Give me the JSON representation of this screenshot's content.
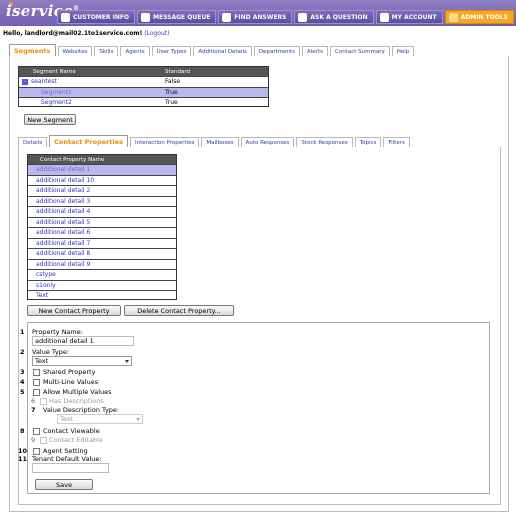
{
  "brand": {
    "logo_text": "service",
    "trademark": "®"
  },
  "topnav": [
    {
      "label": "CUSTOMER INFO",
      "icon": "customer-icon",
      "active": false
    },
    {
      "label": "MESSAGE QUEUE",
      "icon": "envelope-icon",
      "active": false
    },
    {
      "label": "FIND ANSWERS",
      "icon": "book-icon",
      "active": false
    },
    {
      "label": "ASK A QUESTION",
      "icon": "question-icon",
      "active": false
    },
    {
      "label": "MY ACCOUNT",
      "icon": "account-icon",
      "active": false
    },
    {
      "label": "ADMIN TOOLS",
      "icon": "tools-icon",
      "active": true
    }
  ],
  "greeting": {
    "hello": "Hello, landlord@mail02.1to1service.com!",
    "logout": "(Logout)"
  },
  "main_tabs": [
    "Segments",
    "Websites",
    "Skills",
    "Agents",
    "User Types",
    "Additional Details",
    "Departments",
    "Alerts",
    "Contact Summary",
    "Help"
  ],
  "segments": {
    "columns": [
      "Segment Name",
      "Standard"
    ],
    "rows": [
      {
        "name": "seantest",
        "standard": "False",
        "selected": false,
        "expander": "-"
      },
      {
        "name": "Segment1",
        "standard": "True",
        "selected": true
      },
      {
        "name": "Segment2",
        "standard": "True",
        "selected": false
      }
    ],
    "new_button": "New Segment"
  },
  "sub_tabs": [
    "Details",
    "Contact Properties",
    "Interaction Properties",
    "Mailboxes",
    "Auto Responses",
    "Stock Responses",
    "Topics",
    "Filters"
  ],
  "contact_properties": {
    "column": "Contact Property Name",
    "rows": [
      "additional detail 1",
      "additional detail 10",
      "additional detail 2",
      "additional detail 3",
      "additional detail 4",
      "additional detail 5",
      "additional detail 6",
      "additional detail 7",
      "additional detail 8",
      "additional detail 9",
      "cstype",
      "s1only",
      "Text"
    ],
    "selected_index": 0,
    "new_button": "New Contact Property",
    "delete_button": "Delete Contact Property..."
  },
  "form": {
    "numbers": [
      "1",
      "2",
      "3",
      "4",
      "5",
      "6",
      "7",
      "8",
      "9",
      "10",
      "11"
    ],
    "property_name_label": "Property Name:",
    "property_name_value": "additional detail 1",
    "value_type_label": "Value Type:",
    "value_type_value": "Text",
    "shared_property": "Shared Property",
    "multi_line": "Multi-Line Values",
    "allow_multiple": "Allow Multiple Values",
    "has_descriptions": "Has Descriptions",
    "value_desc_type_label": "Value Description Type:",
    "value_desc_type_value": "Text",
    "contact_viewable": "Contact Viewable",
    "contact_editable": "Contact Editable",
    "agent_setting": "Agent Setting",
    "tenant_default_label": "Tenant Default Value:",
    "tenant_default_value": "",
    "save_button": "Save"
  }
}
